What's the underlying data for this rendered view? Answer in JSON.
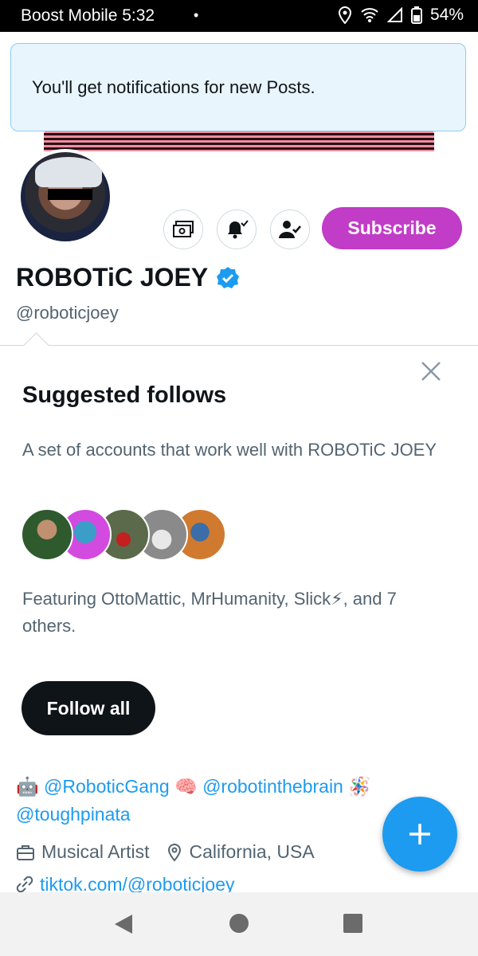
{
  "status_bar": {
    "carrier_time": "Boost Mobile 5:32",
    "dot": "•",
    "battery": "54%"
  },
  "toast": {
    "message": "You'll get notifications for new Posts."
  },
  "profile": {
    "name": "ROBOTiC JOEY",
    "handle": "@roboticjoey",
    "subscribe_label": "Subscribe",
    "verified": true,
    "accent_color": "#c13cc7"
  },
  "suggested": {
    "title": "Suggested follows",
    "description": "A set of accounts that work well with ROBOTiC JOEY",
    "featuring": "Featuring OttoMattic, MrHumanity, Slick⚡, and 7 others.",
    "follow_all_label": "Follow all"
  },
  "bio": {
    "emoji1": "🤖",
    "link1": "@RoboticGang",
    "emoji2": "🧠",
    "link2": "@robotinthebrain",
    "emoji3": "🪅",
    "link3": "@toughpinata"
  },
  "meta": {
    "category": "Musical Artist",
    "location": "California, USA",
    "website": "tiktok.com/@roboticjoey"
  },
  "colors": {
    "link": "#1d9bf0",
    "fab": "#1d9bf0"
  }
}
